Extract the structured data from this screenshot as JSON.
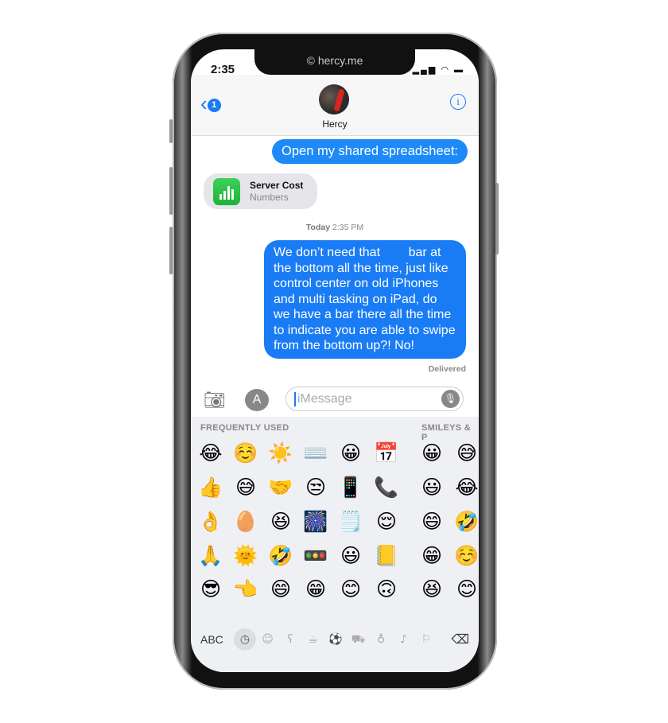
{
  "status": {
    "time": "2:35",
    "notch_text": "© hercy.me",
    "icons": "signal wifi battery"
  },
  "header": {
    "back_count": "1",
    "contact": "Hercy",
    "info": "i"
  },
  "messages": {
    "m1": "Open my shared spreadsheet:",
    "attachment": {
      "title": "Server Cost",
      "subtitle": "Numbers"
    },
    "timestamp_day": "Today",
    "timestamp_time": "2:35 PM",
    "m2": "We don’t need that        bar at the bottom all the time, just like control center on old iPhones and multi tasking on iPad, do we have a bar there all the time to indicate you are able to swipe from the bottom up?! No!",
    "status": "Delivered"
  },
  "composer": {
    "placeholder": "iMessage"
  },
  "keyboard": {
    "section1": "FREQUENTLY USED",
    "section2": "SMILEYS & P",
    "rows": [
      [
        "😂",
        "☺️",
        "☀️",
        "⌨️",
        "😀",
        "📅",
        "😀",
        "😅"
      ],
      [
        "👍",
        "😅",
        "🤝",
        "😒",
        "📱",
        "📞",
        "😃",
        "😂"
      ],
      [
        "👌",
        "🥚",
        "😆",
        "🎆",
        "🗒️",
        "😌",
        "😄",
        "🤣"
      ],
      [
        "🙏",
        "🌞",
        "🤣",
        "🚥",
        "😃",
        "📒",
        "😁",
        "☺️"
      ],
      [
        "😎",
        "👈",
        "😄",
        "😁",
        "😊",
        "🙃",
        "😆",
        "😊"
      ]
    ],
    "abc": "ABC",
    "categories": [
      {
        "icon": "clock-icon",
        "glyph": "◷"
      },
      {
        "icon": "smiley-icon",
        "glyph": "☺"
      },
      {
        "icon": "bear-icon",
        "glyph": "ʕ"
      },
      {
        "icon": "food-icon",
        "glyph": "☕"
      },
      {
        "icon": "ball-icon",
        "glyph": "⚽"
      },
      {
        "icon": "car-icon",
        "glyph": "⛟"
      },
      {
        "icon": "bulb-icon",
        "glyph": "♁"
      },
      {
        "icon": "symbols-icon",
        "glyph": "♪"
      },
      {
        "icon": "flag-icon",
        "glyph": "⚐"
      }
    ],
    "delete": "⌫"
  }
}
